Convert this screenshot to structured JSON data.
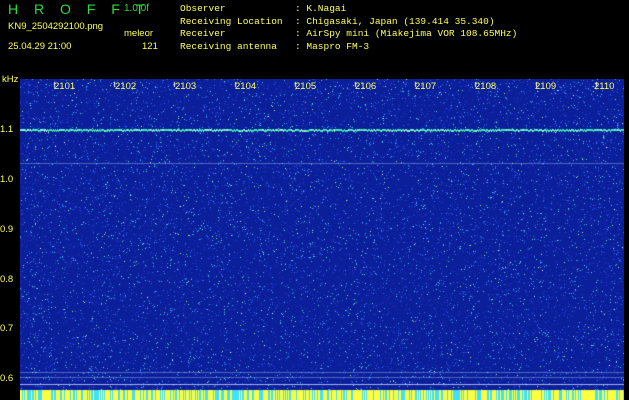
{
  "header": {
    "brand": "H R O F F T",
    "version": "1.0.0f",
    "filename": "KN9_2504292100.png",
    "mode": "meleor",
    "datetime": "25.04.29 21:00",
    "count": "121",
    "fields": [
      {
        "label": "Observer",
        "value": ": K.Nagai"
      },
      {
        "label": "Receiving Location",
        "value": ": Chigasaki, Japan (139.414 35.340)"
      },
      {
        "label": "Receiver",
        "value": ": AirSpy mini (Miakejima VOR 108.65MHz)"
      },
      {
        "label": "Receiving antenna",
        "value": ": Maspro FM-3"
      }
    ]
  },
  "axes": {
    "y_unit": "kHz",
    "y_ticks": [
      "1.1",
      "1.0",
      "0.9",
      "0.8",
      "0.7",
      "0.6"
    ],
    "x_ticks": [
      "2101",
      "2102",
      "2103",
      "2104",
      "2105",
      "2106",
      "2107",
      "2108",
      "2109",
      "2110"
    ]
  },
  "spectrogram": {
    "background_color": "#0c1f9a",
    "noise_colors": [
      "#1d3bd8",
      "#2a6cf0",
      "#38b4f0",
      "#4fe0c8",
      "#a8f06a",
      "#ffffff"
    ],
    "carrier_color": "#40e8b0",
    "bottom_strip_colors": [
      "#ffff40",
      "#40e0ff"
    ]
  }
}
